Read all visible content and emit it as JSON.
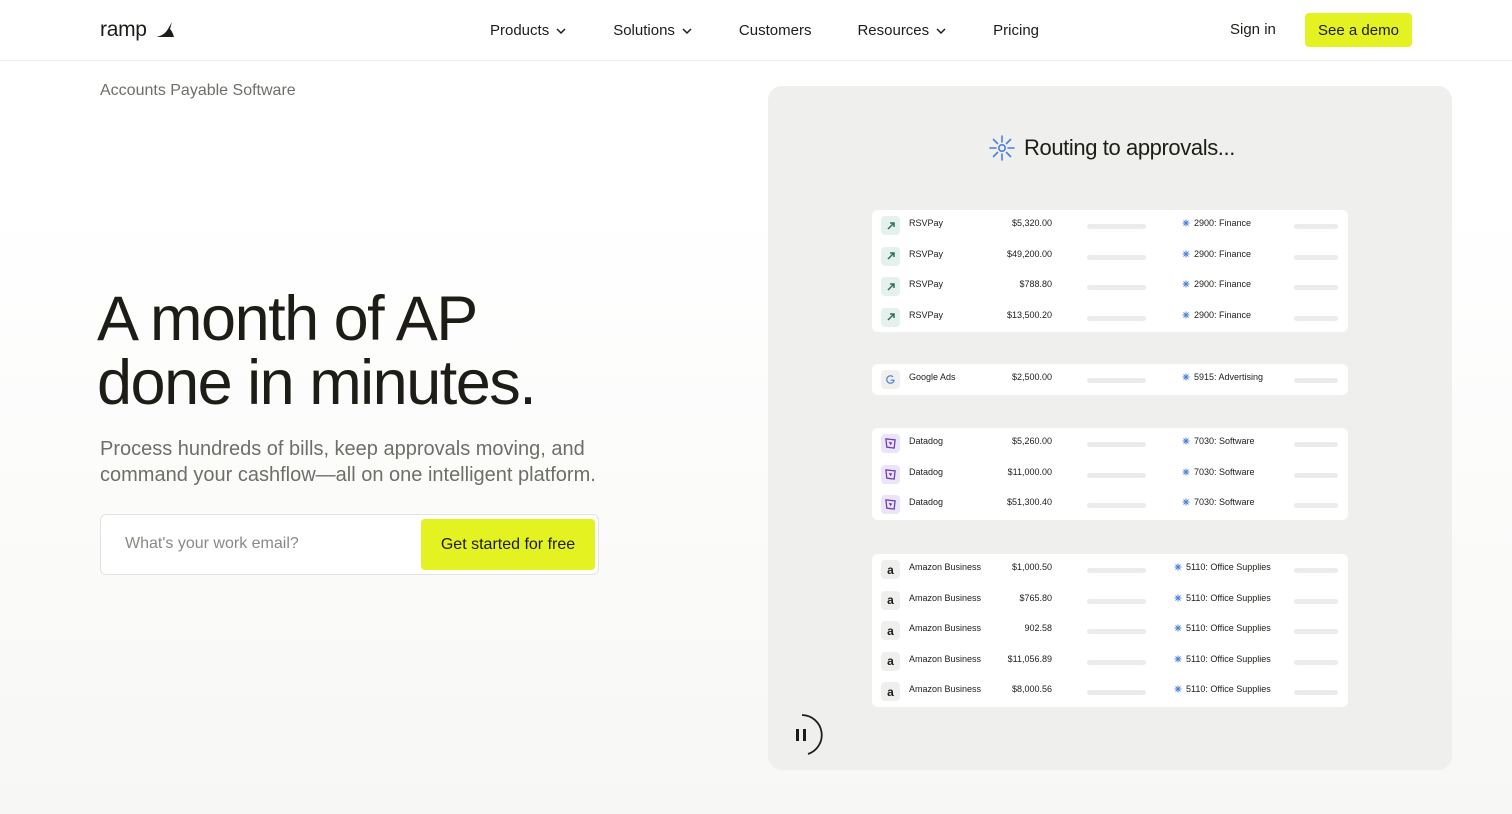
{
  "nav": {
    "logo": "ramp",
    "links": [
      {
        "label": "Products",
        "has_menu": true
      },
      {
        "label": "Solutions",
        "has_menu": true
      },
      {
        "label": "Customers",
        "has_menu": false
      },
      {
        "label": "Resources",
        "has_menu": true
      },
      {
        "label": "Pricing",
        "has_menu": false
      }
    ],
    "sign_in": "Sign in",
    "demo": "See a demo"
  },
  "hero": {
    "eyebrow": "Accounts Payable Software",
    "headline_line1": "A month of AP",
    "headline_line2": "done in minutes.",
    "sub_line1": "Process hundreds of bills, keep approvals moving, and",
    "sub_line2": "command your cashflow—all on one intelligent platform.",
    "email_placeholder": "What's your work email?",
    "cta": "Get started for free"
  },
  "panel": {
    "status": "Routing to approvals...",
    "groups": [
      {
        "vendor_icon": "rsvpay-arrow-icon",
        "rows": [
          {
            "vendor": "RSVPay",
            "amount": "$5,320.00",
            "category": "2900: Finance"
          },
          {
            "vendor": "RSVPay",
            "amount": "$49,200.00",
            "category": "2900: Finance"
          },
          {
            "vendor": "RSVPay",
            "amount": "$788.80",
            "category": "2900: Finance"
          },
          {
            "vendor": "RSVPay",
            "amount": "$13,500.20",
            "category": "2900: Finance"
          }
        ]
      },
      {
        "vendor_icon": "google-icon",
        "rows": [
          {
            "vendor": "Google Ads",
            "amount": "$2,500.00",
            "category": "5915: Advertising"
          }
        ]
      },
      {
        "vendor_icon": "datadog-icon",
        "rows": [
          {
            "vendor": "Datadog",
            "amount": "$5,260.00",
            "category": "7030: Software"
          },
          {
            "vendor": "Datadog",
            "amount": "$11,000.00",
            "category": "7030: Software"
          },
          {
            "vendor": "Datadog",
            "amount": "$51,300.40",
            "category": "7030: Software"
          }
        ]
      },
      {
        "vendor_icon": "amazon-icon",
        "rows": [
          {
            "vendor": "Amazon Business",
            "amount": "$1,000.50",
            "category": "5110: Office Supplies"
          },
          {
            "vendor": "Amazon Business",
            "amount": "$765.80",
            "category": "5110: Office Supplies"
          },
          {
            "vendor": "Amazon Business",
            "amount": "902.58",
            "category": "5110: Office Supplies"
          },
          {
            "vendor": "Amazon Business",
            "amount": "$11,056.89",
            "category": "5110: Office Supplies"
          },
          {
            "vendor": "Amazon Business",
            "amount": "$8,000.56",
            "category": "5110: Office Supplies"
          }
        ]
      }
    ]
  },
  "colors": {
    "accent": "#e4f222",
    "text": "#1d1c17",
    "muted": "#6f6e69",
    "spark": "#4a7fd9"
  }
}
